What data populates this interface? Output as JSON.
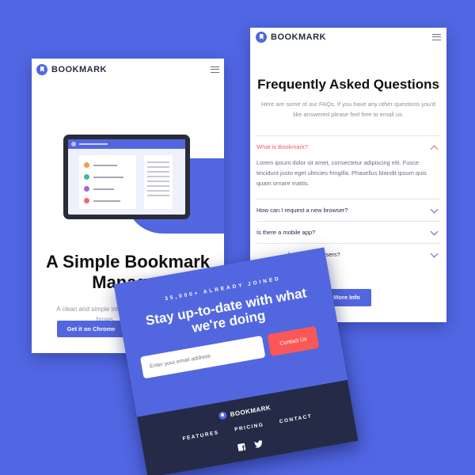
{
  "colors": {
    "background": "#5166e3",
    "primary": "#5267df",
    "accent": "#fa5757",
    "dark": "#252b46"
  },
  "brand": {
    "name": "BOOKMARK",
    "icon": "bookmark-logo-icon"
  },
  "hero": {
    "title": "A Simple Bookmark Manager",
    "text": "A clean and simple interfa… websites. Open a new brows… instantly. Tr…",
    "button": "Get it on Chrome"
  },
  "faq": {
    "title": "Frequently Asked Questions",
    "subtitle": "Here are some of our FAQs. If you have any other questions you'd like answered please feel free to email us.",
    "items": [
      {
        "question": "What is Bookmark?",
        "open": true,
        "answer": "Lorem ipsum dolor sit amet, consectetur adipiscing elit. Fusce tincidunt justo eget ultricies fringilla. Phasellus blandit ipsum quis quam ornare mattis."
      },
      {
        "question": "How can I request a new browser?",
        "open": false
      },
      {
        "question": "Is there a mobile app?",
        "open": false
      },
      {
        "question": "hromium browsers?",
        "open": false
      }
    ],
    "button": "More Info"
  },
  "cta": {
    "kicker": "35,000+ ALREADY JOINED",
    "title": "Stay up-to-date with what we're doing",
    "email_placeholder": "Enter your email address",
    "button": "Contact Us"
  },
  "footer": {
    "links": [
      "FEATURES",
      "PRICING",
      "CONTACT"
    ],
    "social": [
      "facebook-icon",
      "twitter-icon"
    ]
  }
}
